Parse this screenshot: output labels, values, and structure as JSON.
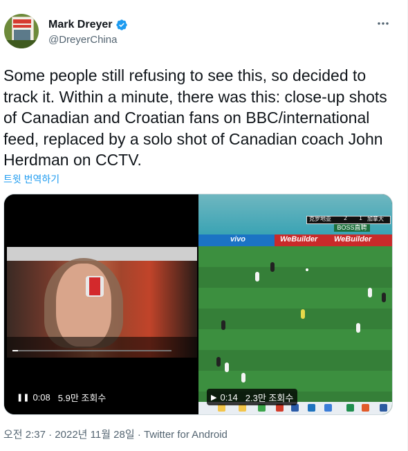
{
  "author": {
    "display_name": "Mark Dreyer",
    "handle": "@DreyerChina",
    "verified": true,
    "avatar_icon": "book-cover-avatar"
  },
  "tweet": {
    "text": "Some people still refusing to see this, so decided to track it. Within a minute, there was this: close-up shots of Canadian and Croatian fans on BBC/international feed, replaced by a solo shot of Canadian coach John Herdman on CCTV.",
    "translate_label": "트윗 번역하기"
  },
  "media": {
    "videos": [
      {
        "state_icon": "pause-icon",
        "state_glyph": "❚❚",
        "time": "0:08",
        "views": "5.9만 조회수"
      },
      {
        "state_icon": "play-icon",
        "state_glyph": "▶",
        "time": "0:14",
        "views": "2.3만 조회수"
      }
    ],
    "scoreboard": {
      "team_left": "克罗地亚",
      "score_left": "2",
      "score_right": "1",
      "team_right": "加拿大",
      "sponsor": "BOSS直聘"
    },
    "ad_boards": [
      "vivo",
      "WeBuilder",
      "WeBuilder"
    ]
  },
  "meta": {
    "timestamp": "오전 2:37 · 2022년 11월 28일",
    "separator": " · ",
    "source": "Twitter for Android"
  },
  "colors": {
    "link": "#1d9bf0",
    "secondary_text": "#536471",
    "primary_text": "#0f1419",
    "verified": "#1d9bf0"
  }
}
